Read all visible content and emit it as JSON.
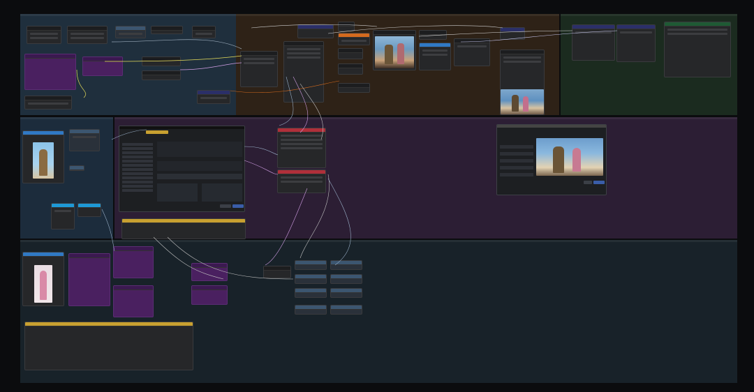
{
  "colors": {
    "background": "#0b0c0e",
    "group_blue": "#1f2f3d",
    "group_brown": "#2e2217",
    "group_green": "#1b2b1f",
    "group_purple": "#2c1e34",
    "group_slate": "#182229",
    "accent_orange": "#d46a1e",
    "accent_red": "#b02f3a",
    "accent_yellow": "#c8a030",
    "accent_blue": "#3079c4"
  },
  "groups": [
    {
      "id": "g1",
      "title": ""
    },
    {
      "id": "g2",
      "title": ""
    },
    {
      "id": "g3",
      "title": ""
    },
    {
      "id": "g4",
      "title": ""
    },
    {
      "id": "g5",
      "title": ""
    },
    {
      "id": "g6",
      "title": ""
    }
  ],
  "panel_text": {
    "title": "",
    "tab_label": "",
    "dialog_title": ""
  },
  "preview_panel": {
    "title": ""
  }
}
